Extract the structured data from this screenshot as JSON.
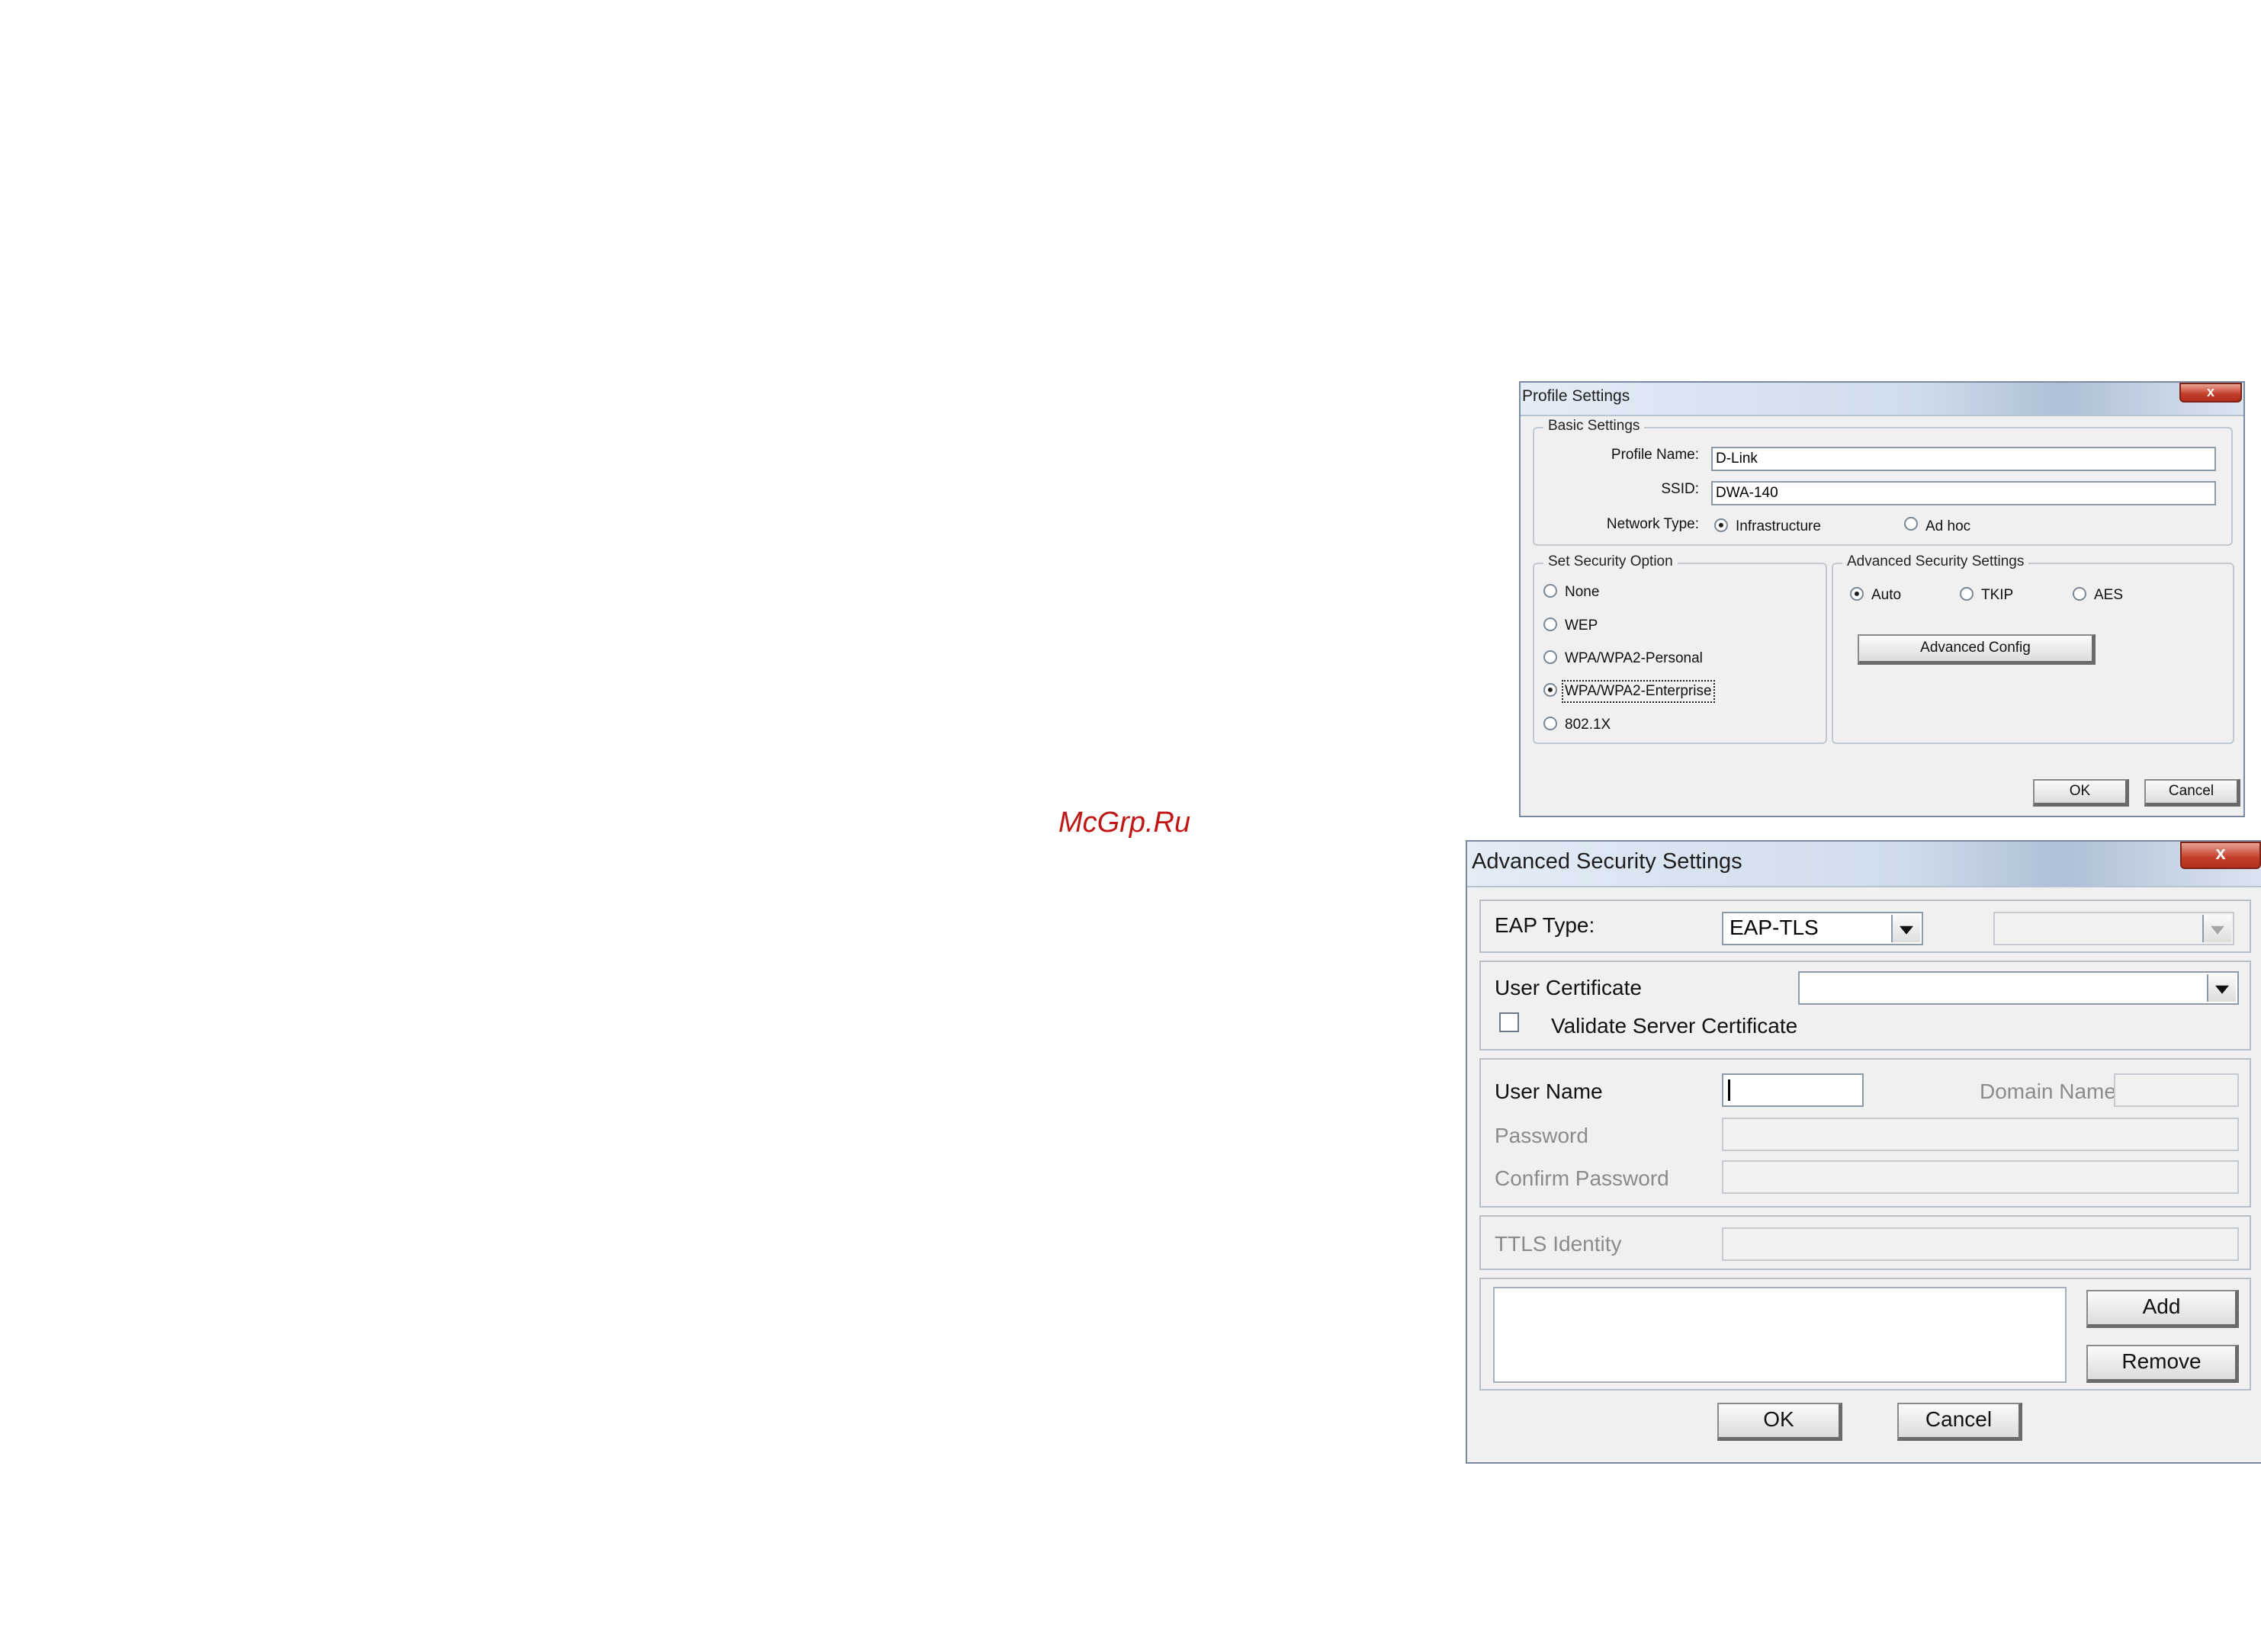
{
  "watermark": "McGrp.Ru",
  "profile": {
    "title": "Profile Settings",
    "close_glyph": "x",
    "basic": {
      "legend": "Basic Settings",
      "profile_name_label": "Profile Name:",
      "profile_name_value": "D-Link",
      "ssid_label": "SSID:",
      "ssid_value": "DWA-140",
      "network_type_label": "Network Type:",
      "infrastructure_label": "Infrastructure",
      "adhoc_label": "Ad hoc",
      "selected_network_type": "Infrastructure"
    },
    "security": {
      "legend": "Set Security Option",
      "options": [
        "None",
        "WEP",
        "WPA/WPA2-Personal",
        "WPA/WPA2-Enterprise",
        "802.1X"
      ],
      "selected": "WPA/WPA2-Enterprise"
    },
    "advanced": {
      "legend": "Advanced Security Settings",
      "cipher_options": [
        "Auto",
        "TKIP",
        "AES"
      ],
      "selected_cipher": "Auto",
      "advanced_config_label": "Advanced Config"
    },
    "ok_label": "OK",
    "cancel_label": "Cancel"
  },
  "adv": {
    "title": "Advanced Security Settings",
    "close_glyph": "x",
    "eap_type_label": "EAP Type:",
    "eap_type_value": "EAP-TLS",
    "eap_secondary_value": "",
    "user_certificate_label": "User Certificate",
    "user_certificate_value": "",
    "validate_server_label": "Validate Server Certificate",
    "validate_server_checked": false,
    "user_name_label": "User Name",
    "user_name_value": "",
    "domain_name_label": "Domain Name",
    "password_label": "Password",
    "confirm_password_label": "Confirm Password",
    "ttls_identity_label": "TTLS Identity",
    "add_label": "Add",
    "remove_label": "Remove",
    "ok_label": "OK",
    "cancel_label": "Cancel"
  }
}
